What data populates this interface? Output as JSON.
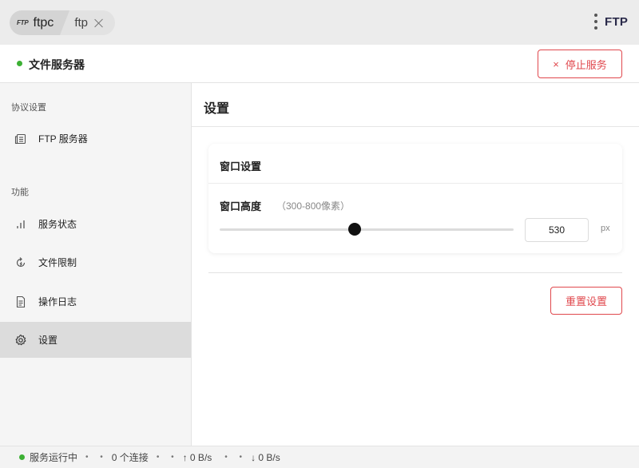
{
  "titlebar": {
    "tabs": [
      {
        "icon_text": "FTP",
        "label": "ftpc"
      },
      {
        "label": "ftp"
      }
    ],
    "brand": "FTP"
  },
  "header": {
    "title": "文件服务器",
    "status_color": "#3cb034",
    "stop_button": {
      "icon": "×",
      "label": "停止服务"
    }
  },
  "sidebar": {
    "sections": [
      {
        "label": "协议设置",
        "items": [
          {
            "label": "FTP 服务器",
            "icon": "server-icon"
          }
        ]
      },
      {
        "label": "功能",
        "items": [
          {
            "label": "服务状态",
            "icon": "bar-chart-icon"
          },
          {
            "label": "文件限制",
            "icon": "refresh-lightning-icon"
          },
          {
            "label": "操作日志",
            "icon": "document-icon"
          },
          {
            "label": "设置",
            "icon": "gear-icon",
            "active": true
          }
        ]
      }
    ]
  },
  "main": {
    "title": "设置",
    "card": {
      "title": "窗口设置",
      "field_label": "窗口高度",
      "field_hint": "（300-800像素）",
      "slider": {
        "min": 300,
        "max": 800,
        "value": 530
      },
      "input_value": "530",
      "unit": "px"
    },
    "reset_button": "重置设置"
  },
  "statusbar": {
    "status": "服务运行中",
    "connections": "0 个连接",
    "upload": "↑ 0 B/s",
    "download": "↓ 0 B/s",
    "separator": "• •"
  },
  "colors": {
    "accent_red": "#e0484d",
    "status_green": "#3cb034"
  }
}
